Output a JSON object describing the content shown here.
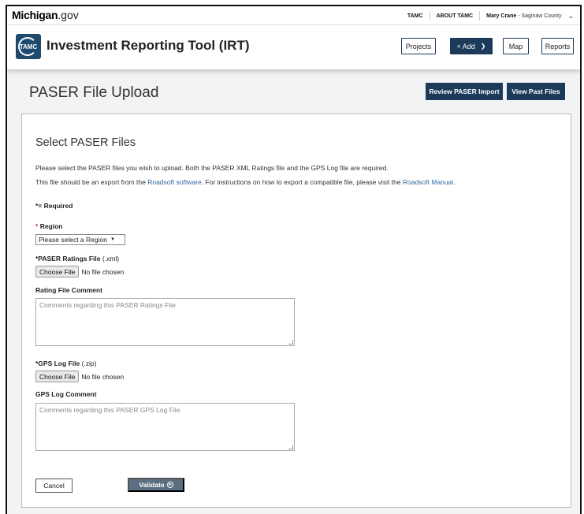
{
  "site": {
    "logo_bold": "Michigan",
    "logo_suffix": ".gov",
    "links": [
      "TAMC",
      "ABOUT TAMC"
    ],
    "user_name": "Mary Crane",
    "user_org": " - Saginaw County"
  },
  "app": {
    "logo_text": "TAMC",
    "title": "Investment Reporting Tool (IRT)",
    "nav": {
      "projects": "Projects",
      "add": "+ Add",
      "map": "Map",
      "reports": "Reports"
    }
  },
  "page": {
    "title": "PASER File Upload",
    "review_button": "Review PASER Import",
    "past_button": "View Past Files"
  },
  "form": {
    "section_title": "Select PASER Files",
    "intro_line1": "Please select the PASER files you wish to upload. Both the PASER XML Ratings file and the GPS Log file are required.",
    "intro_line2_a": "This file should be an export from the ",
    "intro_line2_link1": "Roadsoft software",
    "intro_line2_b": ". For instructions on how to export a compatible file, please visit the ",
    "intro_line2_link2": "Roadsoft Manual",
    "intro_line2_c": ".",
    "required_note": "*= Required",
    "region": {
      "label": "Region",
      "selected": "Please select a Region"
    },
    "ratings_file": {
      "label": "*PASER Ratings File",
      "hint": "(.xml)",
      "choose": "Choose File",
      "status": "No file chosen"
    },
    "rating_comment": {
      "label": "Rating File Comment",
      "placeholder": "Comments regarding this PASER Ratings File"
    },
    "gps_file": {
      "label": "*GPS Log File",
      "hint": "(.zip)",
      "choose": "Choose File",
      "status": "No file chosen"
    },
    "gps_comment": {
      "label": "GPS Log Comment",
      "placeholder": "Comments regarding this PASER GPS Log File"
    },
    "cancel": "Cancel",
    "validate": "Validate"
  },
  "colors": {
    "primary": "#1c3b5a",
    "validate": "#5b6f80",
    "link": "#2d67a3",
    "required": "#c0392b"
  },
  "icons": [
    "chevron-down-icon",
    "tamc-logo-icon",
    "validate-arrow-icon"
  ]
}
